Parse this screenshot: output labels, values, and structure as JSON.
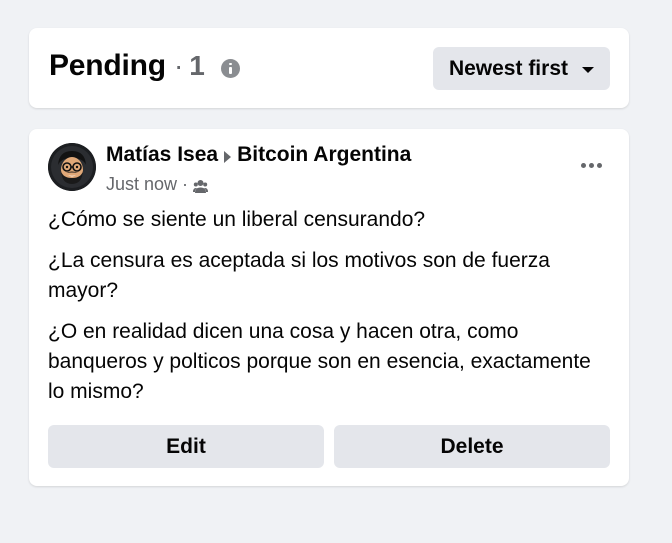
{
  "header": {
    "title": "Pending",
    "separator": "·",
    "count": "1",
    "info_icon": "info-icon",
    "sort": {
      "label": "Newest first",
      "icon": "caret-down-icon"
    }
  },
  "post": {
    "author": "Matías Isea",
    "group": "Bitcoin Argentina",
    "timestamp": "Just now",
    "meta_separator": "·",
    "audience_icon": "group-icon",
    "more_icon": "more-horizontal-icon",
    "paragraphs": [
      "¿Cómo se siente un liberal censurando?",
      "¿La censura es aceptada si los motivos son de fuerza mayor?",
      "¿O en realidad dicen una cosa y hacen otra, como banqueros y polticos porque son en esencia, exactamente lo mismo?"
    ],
    "actions": {
      "edit_label": "Edit",
      "delete_label": "Delete"
    }
  },
  "colors": {
    "background": "#f0f2f5",
    "card": "#ffffff",
    "button_bg": "#e4e6eb",
    "primary_text": "#050505",
    "secondary_text": "#65676b"
  }
}
